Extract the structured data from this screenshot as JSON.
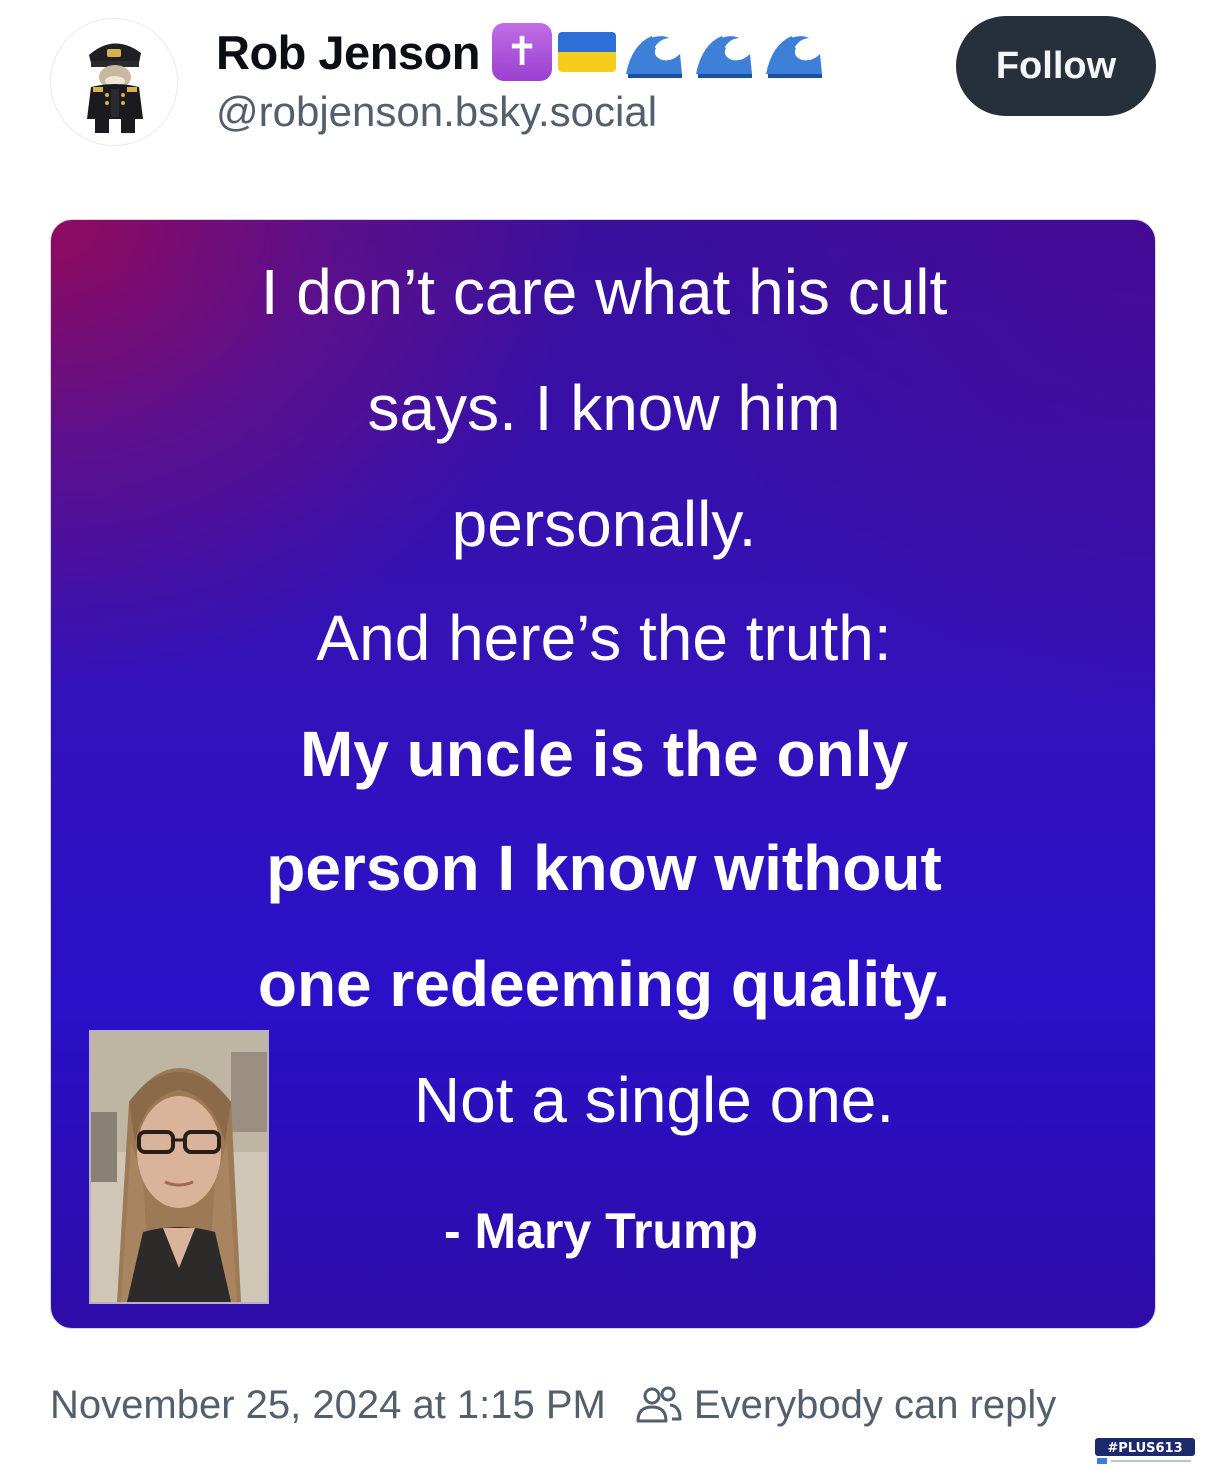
{
  "author": {
    "display_name": "Rob Jenson",
    "handle": "@robjenson.bsky.social",
    "name_emojis": [
      "latin-cross-icon",
      "ukraine-flag-icon",
      "water-wave-icon",
      "water-wave-icon",
      "water-wave-icon"
    ],
    "cross_glyph": "✝"
  },
  "follow_button": {
    "label": "Follow"
  },
  "quote_image": {
    "lines": [
      "I don’t care what his cult",
      "says. I know him",
      "personally.",
      "And here’s the truth:",
      "My uncle is the only",
      "person I know without",
      "one redeeming quality.",
      "Not a single one."
    ],
    "attribution": "- Mary Trump",
    "colors": {
      "background_top_left": "#96095a",
      "background_main": "#3312b8",
      "text": "#ffffff"
    }
  },
  "footer": {
    "timestamp": "November 25, 2024 at 1:15 PM",
    "reply_setting": "Everybody can reply"
  },
  "watermark": {
    "text": "#PLUS613"
  },
  "colors": {
    "follow_button_bg": "#27303a",
    "secondary_text": "#52606d"
  }
}
